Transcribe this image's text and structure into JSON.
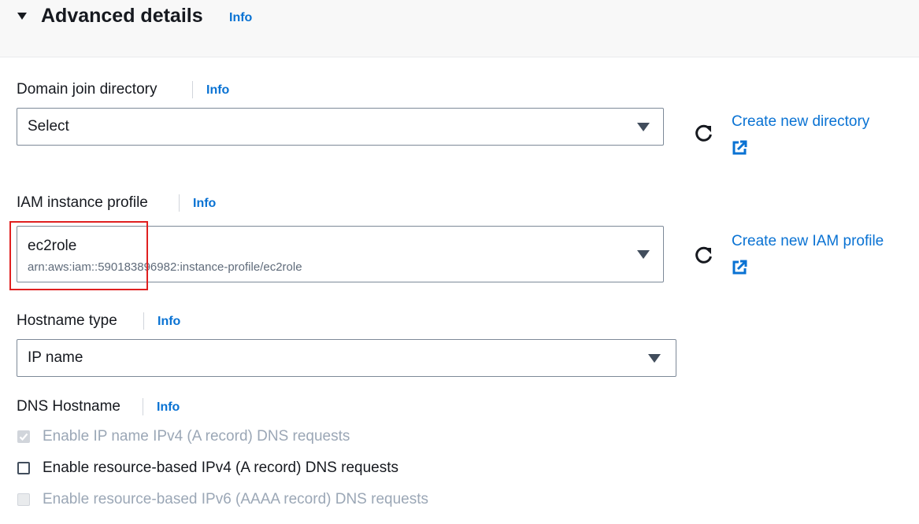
{
  "section": {
    "title": "Advanced details",
    "info": "Info"
  },
  "domain_join": {
    "label": "Domain join directory",
    "info": "Info",
    "value": "Select",
    "create_link": "Create new directory"
  },
  "iam_profile": {
    "label": "IAM instance profile",
    "info": "Info",
    "value": "ec2role",
    "sub_value": "arn:aws:iam::590183896982:instance-profile/ec2role",
    "create_link": "Create new IAM profile"
  },
  "hostname_type": {
    "label": "Hostname type",
    "info": "Info",
    "value": "IP name"
  },
  "dns_hostname": {
    "label": "DNS Hostname",
    "info": "Info",
    "options": [
      {
        "label": "Enable IP name IPv4 (A record) DNS requests",
        "checked": true,
        "disabled": true
      },
      {
        "label": "Enable resource-based IPv4 (A record) DNS requests",
        "checked": false,
        "disabled": false
      },
      {
        "label": "Enable resource-based IPv6 (AAAA record) DNS requests",
        "checked": false,
        "disabled": true
      }
    ]
  },
  "colors": {
    "link": "#0972d3",
    "highlight": "#e02020",
    "text": "#16191f",
    "muted": "#5f6b7a",
    "disabled": "#9ba7b6"
  },
  "icons": [
    "expand-caret-icon",
    "refresh-icon",
    "external-link-icon",
    "dropdown-caret-icon",
    "checkbox-icon"
  ]
}
